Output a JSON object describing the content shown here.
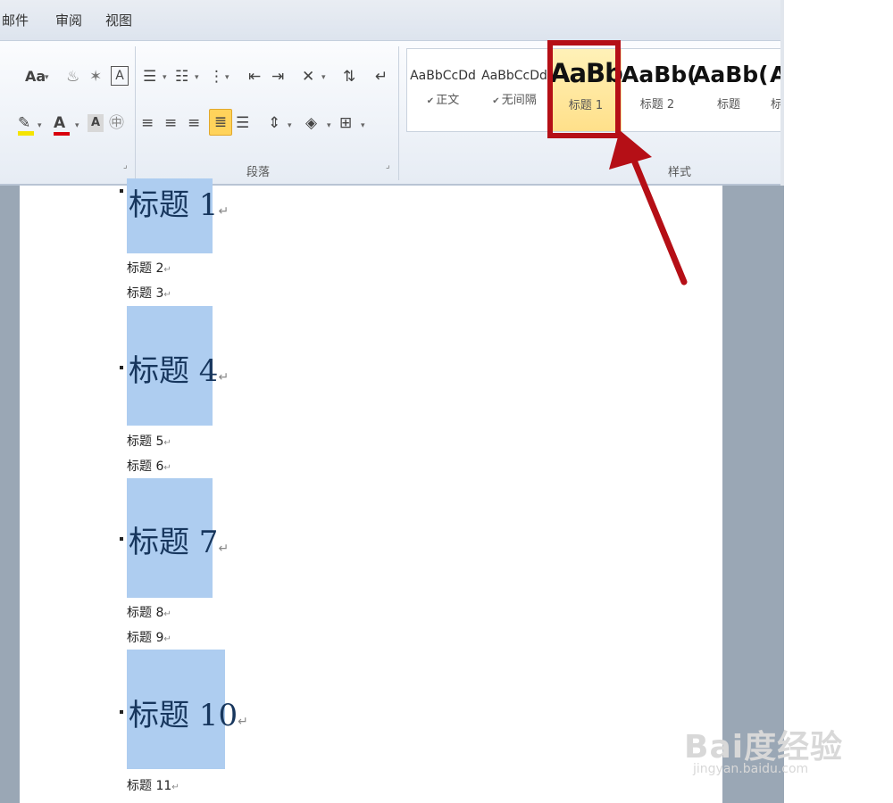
{
  "tabs": {
    "mail": "邮件",
    "review": "审阅",
    "view": "视图"
  },
  "ribbon": {
    "font_group": {
      "change_case": "Aa",
      "font_color_letter": "A",
      "char_shading_letter": "A",
      "char_border_letter": "A"
    },
    "paragraph_group": {
      "label": "段落"
    },
    "styles_group": {
      "label": "样式",
      "items": [
        {
          "preview": "AaBbCcDd",
          "name": "正文"
        },
        {
          "preview": "AaBbCcDd",
          "name": "无间隔"
        },
        {
          "preview": "AaBb",
          "name": "标题 1"
        },
        {
          "preview": "AaBb(",
          "name": "标题 2"
        },
        {
          "preview": "AaBb(",
          "name": "标题"
        },
        {
          "preview": "A",
          "name": "标题"
        }
      ],
      "highlighted": "标题 1"
    }
  },
  "document": {
    "headings": [
      "标题 1",
      "标题 4",
      "标题 7",
      "标题 10"
    ],
    "subs": [
      "标题 2",
      "标题 3",
      "标题 5",
      "标题 6",
      "标题 8",
      "标题 9",
      "标题 11"
    ]
  },
  "watermark": {
    "logo": "Bai度经验",
    "url": "jingyan.baidu.com"
  },
  "colors": {
    "highlight_red": "#b50f16",
    "heading_block": "#aecdf0",
    "selected_style_bg": "#ffe08a"
  },
  "icons": [
    "bullets-icon",
    "numbering-icon",
    "multilevel-list-icon",
    "decrease-indent-icon",
    "increase-indent-icon",
    "sort-icon",
    "show-marks-icon",
    "align-left-icon",
    "align-center-icon",
    "align-right-icon",
    "justify-icon",
    "distribute-icon",
    "line-spacing-icon",
    "shading-icon",
    "borders-icon",
    "highlighter-icon"
  ]
}
